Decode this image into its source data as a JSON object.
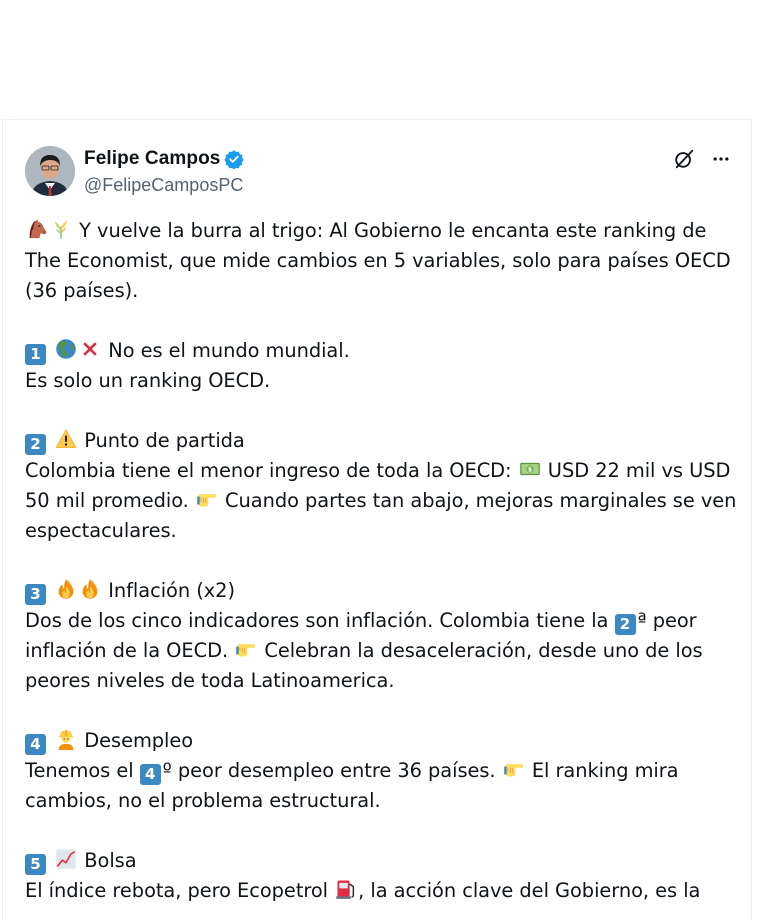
{
  "author": {
    "name": "Felipe Campos",
    "handle": "@FelipeCamposPC",
    "verified": true,
    "verified_color": "#1d9bf0"
  },
  "icons": {
    "avatar": "profile-photo",
    "verified": "verified-badge-icon",
    "grok": "grok-icon",
    "more": "more-options-icon"
  },
  "tweet": {
    "intro": {
      "emojis": [
        "horse-face",
        "sheaf-of-rice"
      ],
      "text": "Y vuelve la burra al trigo: Al Gobierno le encanta este ranking de The Economist, que mide cambios en 5 variables, solo para países OECD (36 países)."
    },
    "point1": {
      "number": "1",
      "emojis": [
        "globe-americas",
        "cross-mark"
      ],
      "title": "No es el mundo mundial.",
      "body": "Es solo un ranking OECD."
    },
    "point2": {
      "number": "2",
      "emojis": [
        "warning"
      ],
      "title": "Punto de partida",
      "body_before": "Colombia tiene el menor ingreso de toda la OECD:",
      "body_emoji": "dollar-banknote",
      "body_middle": "USD 22 mil vs USD 50 mil promedio.",
      "body_emoji2": "backhand-index-pointing-right",
      "body_after": "Cuando partes tan abajo, mejoras marginales se ven espectaculares."
    },
    "point3": {
      "number": "3",
      "emojis": [
        "fire",
        "fire"
      ],
      "title": "Inflación (x2)",
      "body_before": "Dos de los cinco indicadores son inflación. Colombia tiene la",
      "inline_number": "2",
      "body_ordinal": "ª peor inflación de la OECD.",
      "body_emoji": "backhand-index-pointing-right",
      "body_after": "Celebran la desaceleración, desde uno de los peores niveles de toda Latinoamerica."
    },
    "point4": {
      "number": "4",
      "emojis": [
        "construction-worker"
      ],
      "title": "Desempleo",
      "body_before": "Tenemos el",
      "inline_number": "4",
      "body_ordinal": "º peor desempleo entre 36 países.",
      "body_emoji": "backhand-index-pointing-right",
      "body_after": "El ranking mira cambios, no el problema estructural."
    },
    "point5": {
      "number": "5",
      "emojis": [
        "chart-increasing"
      ],
      "title": "Bolsa",
      "body_before": "El índice rebota, pero Ecopetrol",
      "body_emoji": "fuel-pump",
      "body_after": ", la acción clave del Gobierno, es la"
    }
  },
  "colors": {
    "text": "#0f1419",
    "secondary": "#536471",
    "keycap": "#3b88c3"
  }
}
